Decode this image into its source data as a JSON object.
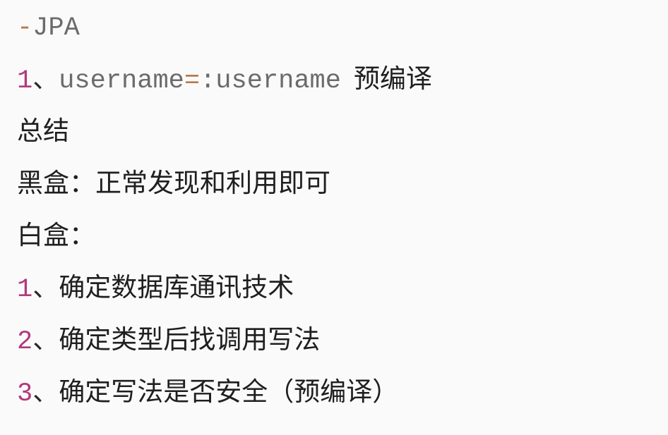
{
  "lines": [
    {
      "prefix": "-",
      "text": "JPA"
    },
    {
      "num": "1",
      "sep": "、",
      "code_a": "username",
      "op": "=",
      "colon": ":",
      "code_b": "username",
      "text": "预编译"
    },
    {
      "text": "总结"
    },
    {
      "text": "黑盒：正常发现和利用即可"
    },
    {
      "text": "白盒："
    },
    {
      "num": "1",
      "sep": "、",
      "text": "确定数据库通讯技术"
    },
    {
      "num": "2",
      "sep": "、",
      "text": "确定类型后找调用写法"
    },
    {
      "num": "3",
      "sep": "、",
      "text": "确定写法是否安全（预编译）"
    }
  ],
  "colors": {
    "number": "#b03a7d",
    "prefix": "#b57b4a",
    "code": "#6b6b6b",
    "text": "#1f1f1f",
    "background": "#fafafa"
  }
}
